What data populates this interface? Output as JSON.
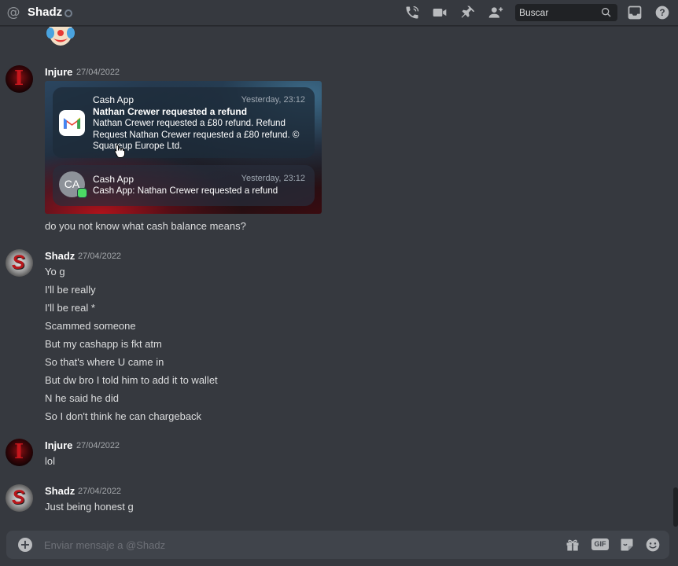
{
  "header": {
    "channel_name": "Shadz",
    "search_placeholder": "Buscar"
  },
  "embed": {
    "notifications": [
      {
        "app": "Cash App",
        "time": "Yesterday, 23:12",
        "title": "Nathan Crewer requested a refund",
        "body": "Nathan Crewer requested a £80 refund. Refund Request Nathan Crewer requested a £80 refund. © Squareup Europe Ltd."
      },
      {
        "app": "Cash App",
        "time": "Yesterday, 23:12",
        "avatar_initials": "CA",
        "body": "Cash App: Nathan Crewer requested a refund"
      }
    ]
  },
  "messages": [
    {
      "author": "Injure",
      "timestamp": "27/04/2022",
      "lines": [
        "do you not know what cash balance means?"
      ]
    },
    {
      "author": "Shadz",
      "timestamp": "27/04/2022",
      "lines": [
        "Yo g",
        "I'll be really",
        "I'll be real *",
        "Scammed someone",
        "But my cashapp is fkt atm",
        "So that's where U came in",
        "But dw bro I told him to add it to wallet",
        "N he said he did",
        "So I don't think he can chargeback"
      ]
    },
    {
      "author": "Injure",
      "timestamp": "27/04/2022",
      "lines": [
        "lol"
      ]
    },
    {
      "author": "Shadz",
      "timestamp": "27/04/2022",
      "lines": [
        "Just being honest g"
      ]
    }
  ],
  "composer": {
    "placeholder": "Enviar mensaje a @Shadz",
    "gif_label": "GIF"
  },
  "colors": {
    "background": "#36393f",
    "composer": "#40444b",
    "text": "#dcddde",
    "muted": "#a3a6aa"
  }
}
